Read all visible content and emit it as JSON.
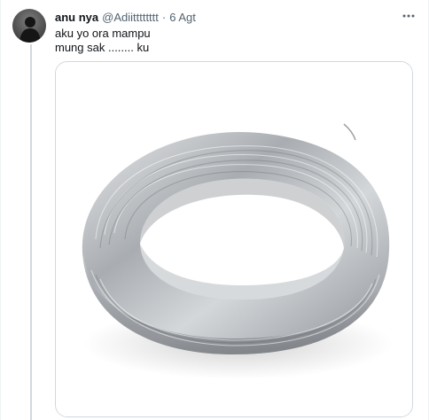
{
  "tweet": {
    "display_name": "anu nya",
    "handle": "@Adiitttttttt",
    "separator": "·",
    "time": "6 Agt",
    "text_lines": [
      "aku yo ora mampu",
      "mung sak ........ ku"
    ],
    "more_icon": "more-horizontal-icon",
    "avatar_icon": "avatar-silhouette",
    "media_subject": "wire-coil"
  },
  "colors": {
    "text_primary": "#0f1419",
    "text_secondary": "#536471",
    "border": "#cfd9de",
    "thread_line": "#cfd9de"
  }
}
